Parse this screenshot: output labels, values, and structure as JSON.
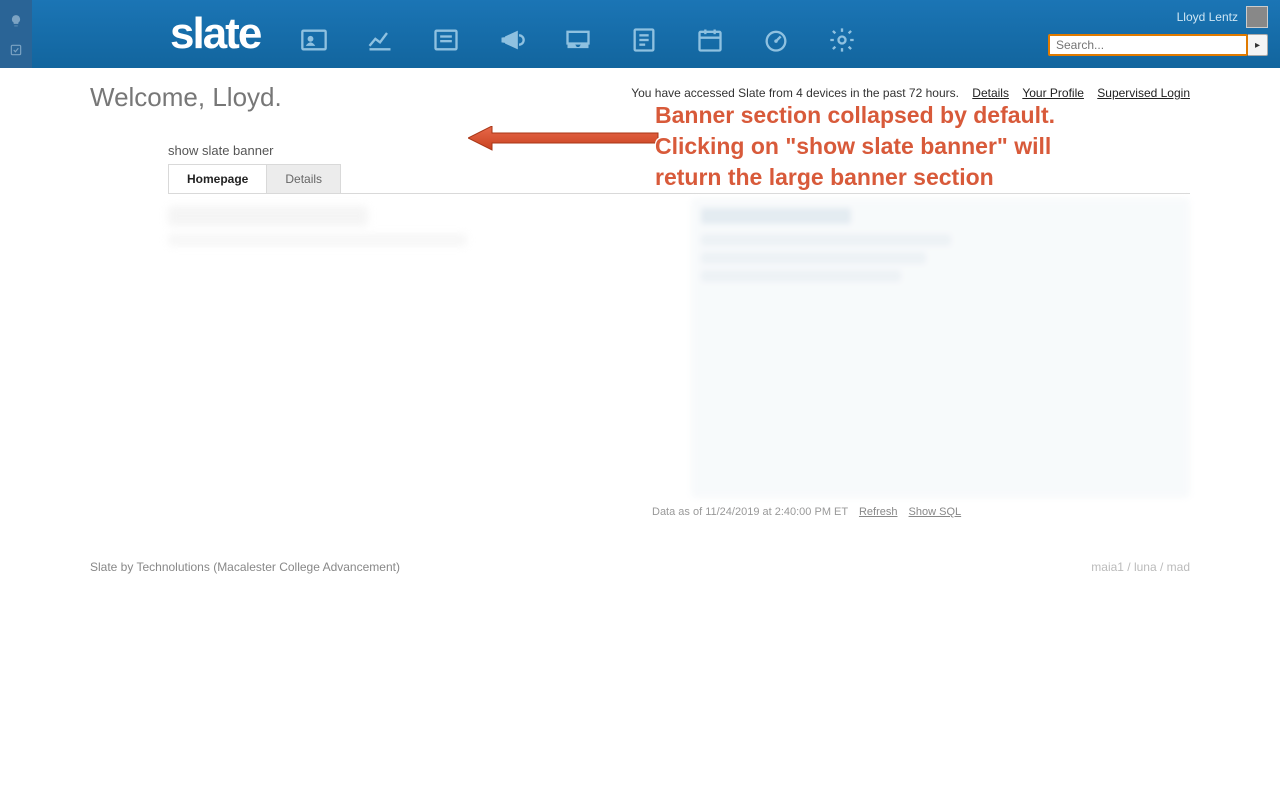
{
  "header": {
    "logo_text": "slate",
    "user_name": "Lloyd Lentz",
    "search_placeholder": "Search...",
    "nav_icons": [
      "contact-card-icon",
      "chart-icon",
      "form-icon",
      "megaphone-icon",
      "inbox-icon",
      "report-icon",
      "calendar-icon",
      "dashboard-icon",
      "gear-icon"
    ]
  },
  "welcome": "Welcome, Lloyd.",
  "info_bar": {
    "text": "You have accessed Slate from 4 devices in the past 72 hours.",
    "links": {
      "details": "Details",
      "profile": "Your Profile",
      "supervised": "Supervised Login"
    }
  },
  "banner_toggle": "show slate banner",
  "tabs": {
    "homepage": "Homepage",
    "details": "Details"
  },
  "data_footer": {
    "asof": "Data as of 11/24/2019 at 2:40:00 PM ET",
    "refresh": "Refresh",
    "show_sql": "Show SQL"
  },
  "footer": {
    "left": "Slate by Technolutions (Macalester College Advancement)",
    "right": "maia1 / luna / mad"
  },
  "annotation": {
    "line1": "Banner section collapsed by default.",
    "line2": "Clicking on \"show slate banner\" will",
    "line3": "return the large banner section"
  }
}
